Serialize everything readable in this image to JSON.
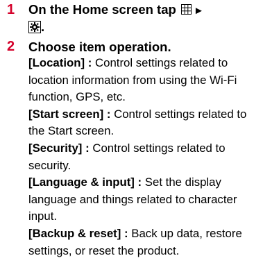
{
  "steps": [
    {
      "number": "1",
      "title_prefix": "On the Home screen tap",
      "arrow": "►",
      "title_suffix": ".",
      "icons": [
        "apps-grid-icon",
        "settings-gear-icon"
      ]
    },
    {
      "number": "2",
      "title": "Choose item operation.",
      "items": [
        {
          "key": "[Location] :",
          "text": " Control settings related to location information from using the Wi-Fi function, GPS, etc."
        },
        {
          "key": "[Start screen] :",
          "text": " Control settings related to the Start screen."
        },
        {
          "key": "[Security] :",
          "text": " Control settings related to security."
        },
        {
          "key": "[Language & input] :",
          "text": " Set the display language and things related to character input."
        },
        {
          "key": "[Backup & reset] :",
          "text": " Back up data, restore settings, or reset the product."
        }
      ]
    }
  ],
  "colors": {
    "step_number": "#d4002a",
    "text": "#000000"
  }
}
